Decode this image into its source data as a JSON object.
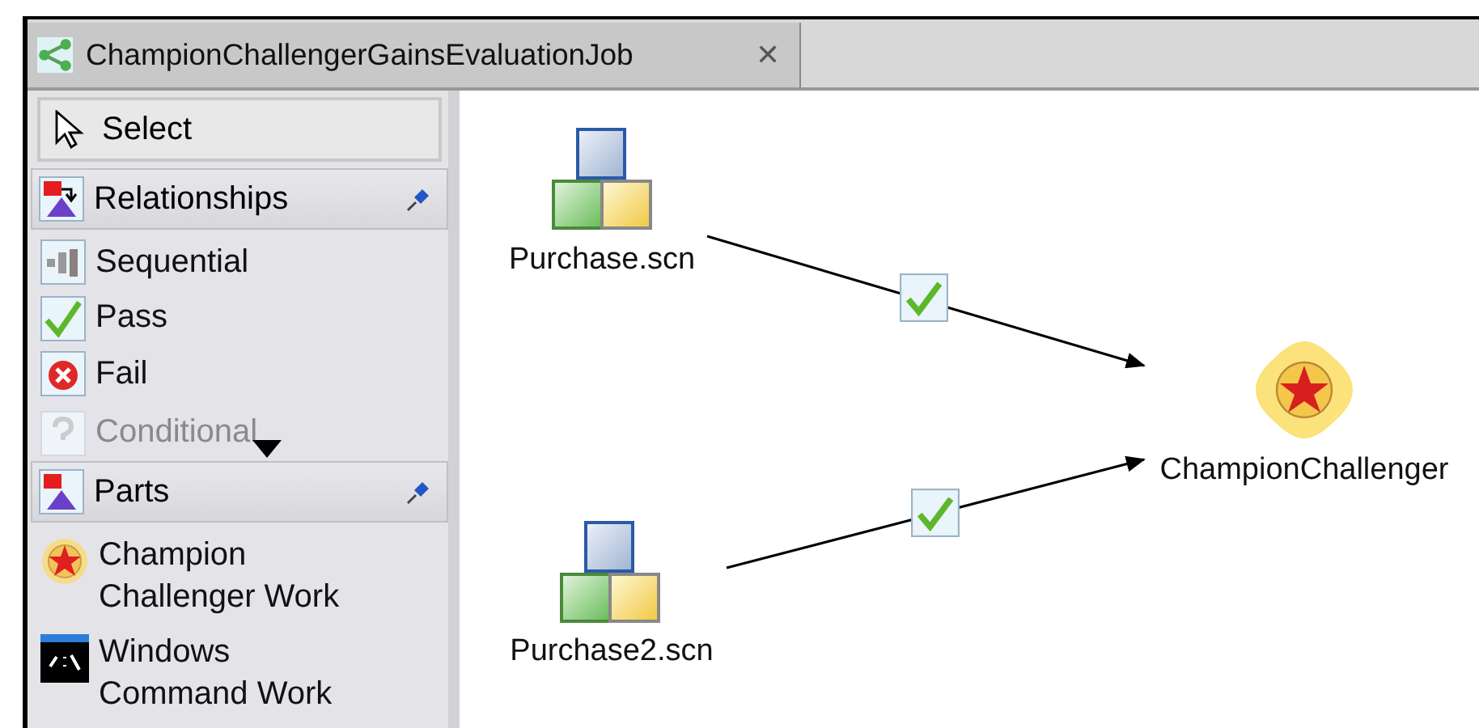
{
  "editor_tab": {
    "title": "ChampionChallengerGainsEvaluationJob",
    "close": "✕"
  },
  "palette": {
    "tool": {
      "label": "Select",
      "kind": "select"
    },
    "drawers": [
      {
        "label": "Relationships",
        "kind": "relationships",
        "pinned": true,
        "items": [
          {
            "label": "Sequential",
            "kind": "sequential",
            "disabled": false
          },
          {
            "label": "Pass",
            "kind": "pass",
            "disabled": false
          },
          {
            "label": "Fail",
            "kind": "fail",
            "disabled": false
          },
          {
            "label": "Conditional",
            "kind": "conditional",
            "disabled": true
          }
        ]
      },
      {
        "label": "Parts",
        "kind": "parts",
        "pinned": true,
        "items": [
          {
            "label": "Champion Challenger Work",
            "kind": "champion",
            "disabled": false
          },
          {
            "label": "Windows Command Work",
            "kind": "command",
            "disabled": false
          }
        ]
      }
    ]
  },
  "diagram": {
    "nodes": [
      {
        "label": "Purchase.scn",
        "kind": "scenario"
      },
      {
        "label": "Purchase2.scn",
        "kind": "scenario"
      },
      {
        "label": "ChampionChallenger",
        "kind": "champion"
      }
    ],
    "edges": [
      {
        "kind": "pass"
      },
      {
        "kind": "pass"
      }
    ]
  }
}
